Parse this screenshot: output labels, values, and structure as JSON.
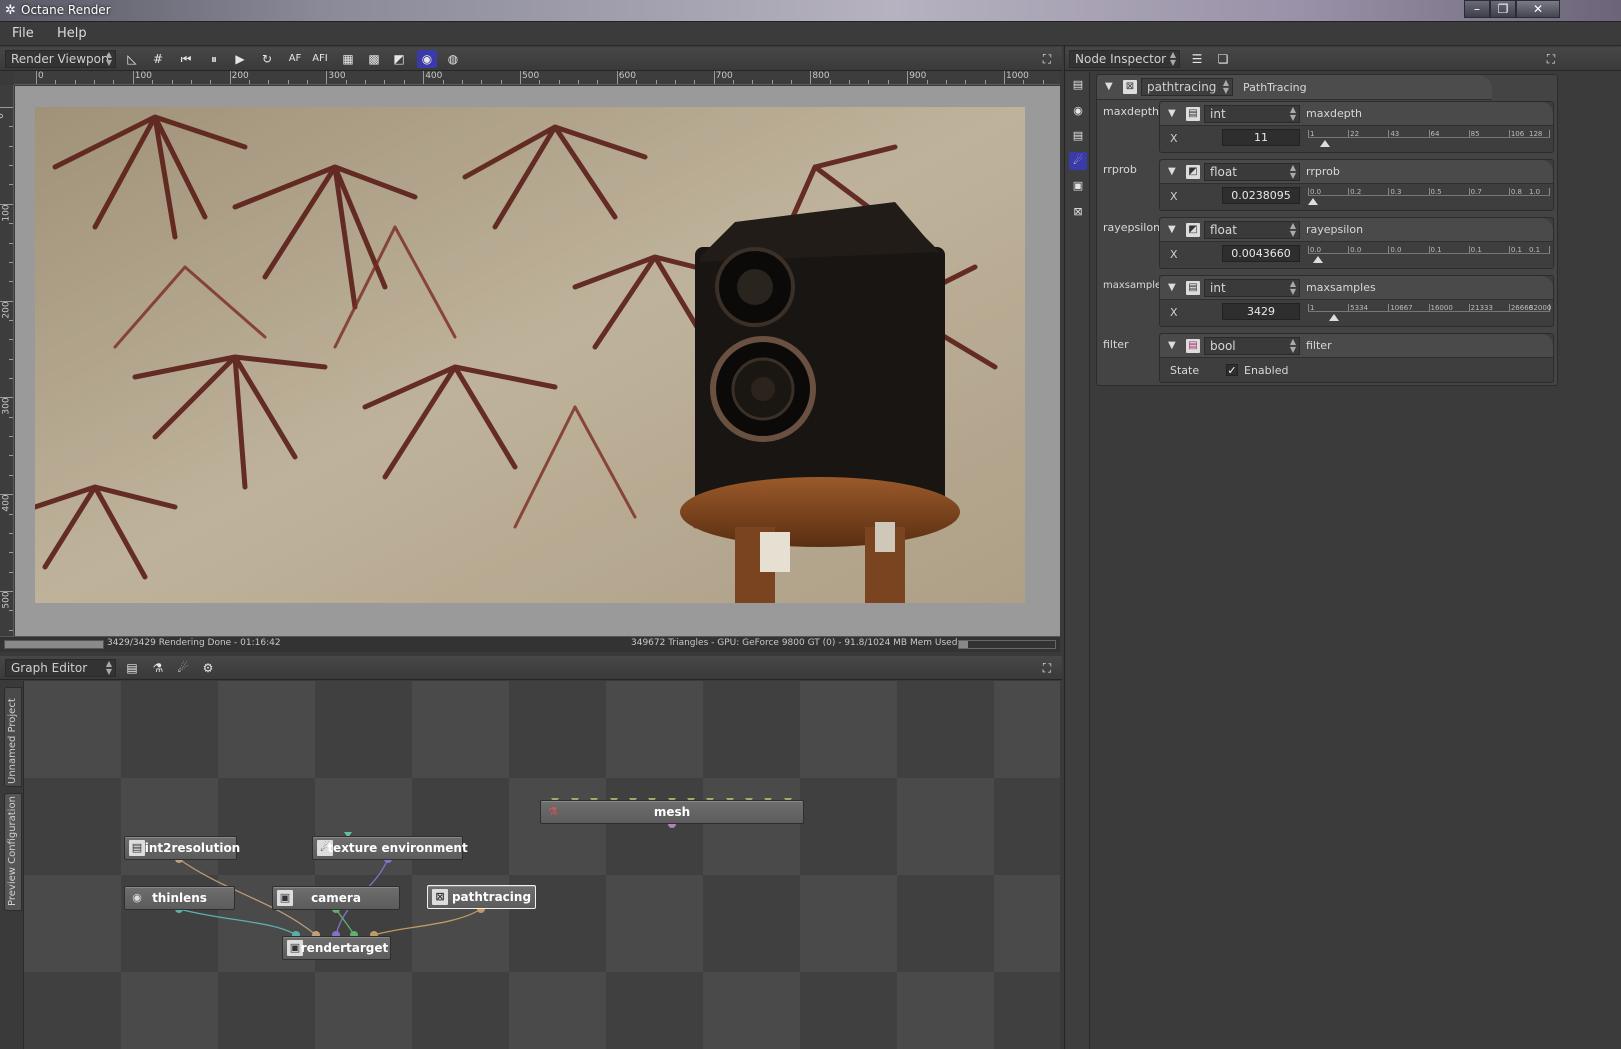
{
  "window": {
    "title": "Octane Render",
    "minimize": "–",
    "restore": "❐",
    "close": "✕"
  },
  "menu": {
    "items": [
      "File",
      "Help"
    ]
  },
  "viewport": {
    "panel_label": "Render Viewport",
    "ruler_top_labels": [
      "0",
      "100",
      "200",
      "300",
      "400",
      "500",
      "600",
      "700",
      "800",
      "900",
      "1000"
    ],
    "ruler_left_labels": [
      "0",
      "100",
      "200",
      "300",
      "400",
      "500"
    ],
    "toolbar_af": "AF",
    "toolbar_afi": "AFI"
  },
  "status": {
    "render_progress": 1.0,
    "left_text": "3429/3429 Rendering Done - 01:16:42",
    "right_text": "349672 Triangles - GPU: GeForce 9800 GT (0) - 91.8/1024 MB Mem Used",
    "memory_fraction": 0.09
  },
  "graph_editor": {
    "panel_label": "Graph Editor",
    "side_tabs": [
      "Unnamed Project",
      "Preview Configuration"
    ],
    "nodes": {
      "mesh": "mesh",
      "int2resolution": "int2resolution",
      "texture_environment": "texture environment",
      "thinlens": "thinlens",
      "camera": "camera",
      "pathtracing": "pathtracing",
      "rendertarget": "rendertarget"
    }
  },
  "inspector": {
    "panel_label": "Node Inspector",
    "node_name": "pathtracing",
    "node_type": "PathTracing",
    "params": [
      {
        "name": "maxdepth",
        "type": "int",
        "label": "maxdepth",
        "axis": "X",
        "value": "11",
        "fraction": 0.07,
        "ticks": [
          "1",
          "22",
          "43",
          "64",
          "85",
          "106",
          "128"
        ]
      },
      {
        "name": "rrprob",
        "type": "float",
        "label": "rrprob",
        "axis": "X",
        "value": "0.0238095",
        "fraction": 0.02,
        "ticks": [
          "0.0",
          "0.2",
          "0.3",
          "0.5",
          "0.7",
          "0.8",
          "1.0"
        ]
      },
      {
        "name": "rayepsilon",
        "type": "float",
        "label": "rayepsilon",
        "axis": "X",
        "value": "0.0043660",
        "fraction": 0.04,
        "ticks": [
          "0.0",
          "0.0",
          "0.0",
          "0.1",
          "0.1",
          "0.1",
          "0.1"
        ]
      },
      {
        "name": "maxsamples",
        "type": "int",
        "label": "maxsamples",
        "axis": "X",
        "value": "3429",
        "fraction": 0.107,
        "ticks": [
          "1",
          "5334",
          "10667",
          "16000",
          "21333",
          "26666",
          "32000"
        ]
      }
    ],
    "filter": {
      "name": "filter",
      "type": "bool",
      "label": "filter",
      "state_label": "State",
      "enabled_label": "Enabled",
      "checked": true
    }
  },
  "colors": {
    "accent": "#3a3aa8",
    "panel": "#3b3b3b",
    "node": "#666666"
  }
}
